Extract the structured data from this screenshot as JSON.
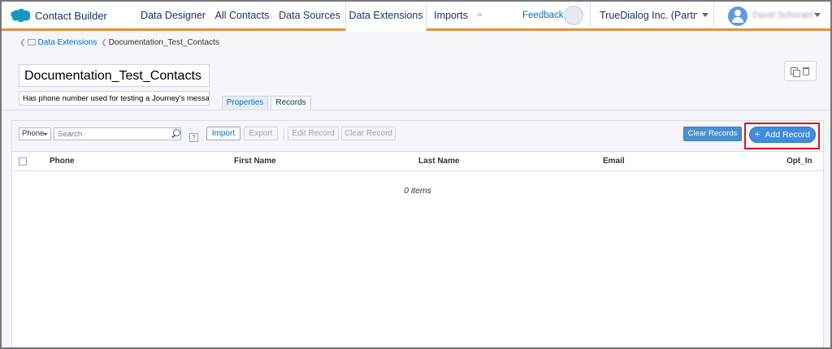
{
  "app": {
    "title": "Contact Builder"
  },
  "nav": {
    "items": [
      "Data Designer",
      "All Contacts",
      "Data Sources",
      "Data Extensions",
      "Imports"
    ],
    "active": "Data Extensions",
    "more_glyph": "»",
    "feedback": "Feedback",
    "org_name": "TrueDialog Inc. (Partner...",
    "user_name": "David Schonert"
  },
  "breadcrumb": {
    "parent": "Data Extensions",
    "current": "Documentation_Test_Contacts"
  },
  "extension": {
    "name": "Documentation_Test_Contacts",
    "description": "Has phone number used for testing a Journey's message"
  },
  "tabs": [
    {
      "label": "Properties",
      "active": false
    },
    {
      "label": "Records",
      "active": true
    }
  ],
  "toolbar": {
    "filter_field": "Phone",
    "search_placeholder": "Search",
    "help": "?",
    "import": "Import",
    "export": "Export",
    "edit_record": "Edit Record",
    "clear_record": "Clear Record",
    "clear_records": "Clear Records",
    "add_record": "Add Record",
    "add_icon": "+"
  },
  "table": {
    "columns": [
      "Phone",
      "First Name",
      "Last Name",
      "Email",
      "Opt_In"
    ],
    "empty_text": "0 items"
  },
  "colors": {
    "accent": "#e8913c",
    "primary": "#3f8ede",
    "highlight": "#e0141d"
  }
}
